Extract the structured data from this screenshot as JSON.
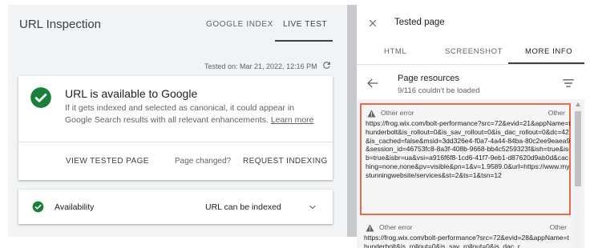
{
  "left_panel": {
    "title": "URL Inspection",
    "tabs": [
      {
        "label": "GOOGLE INDEX"
      },
      {
        "label": "LIVE TEST"
      }
    ],
    "tested_on": "Tested on: Mar 21, 2022, 12:16 PM",
    "status_card": {
      "title": "URL is available to Google",
      "description": "If it gets indexed and selected as canonical, it could appear in Google Search results with all relevant enhancements.",
      "learn_more": "Learn more",
      "view_tested_page": "VIEW TESTED PAGE",
      "page_changed": "Page changed?",
      "request_indexing": "REQUEST INDEXING"
    },
    "availability": {
      "label": "Availability",
      "value": "URL can be indexed"
    }
  },
  "right_panel": {
    "title": "Tested page",
    "tabs": [
      {
        "label": "HTML"
      },
      {
        "label": "SCREENSHOT"
      },
      {
        "label": "MORE INFO"
      }
    ],
    "resources": {
      "title": "Page resources",
      "subtitle": "9/116 couldn't be loaded"
    },
    "errors": [
      {
        "title": "Other error",
        "kind": "Other",
        "url": "https://frog.wix.com/bolt-performance?src=72&evid=21&appName=thunderbolt&is_rollout=0&is_sav_rollout=0&is_dac_rollout=0&dc=42&is_cached=false&msid=3dd326e4-f0a7-4a44-84ba-80c2ee9eaea9&session_id=46753fc8-8a3f-408b-9668-bb4c5259323f&ish=true&isb=true&isbr=ua&vsi=a916f6f8-1cd6-41f7-9eb1-d87620d9ab0d&caching=none,none&pv=visible&pn=1&v=1.9589.0&url=https://www.mystunningwebsite/services&st=2&ts=1&tsn=12"
      },
      {
        "title": "Other error",
        "kind": "Other",
        "url": "https://frog.wix.com/bolt-performance?src=72&evid=28&appName=thunderbolt&is_rollout=0&is_sav_rollout=0&is_dac_r"
      }
    ]
  },
  "colors": {
    "success_green": "#188038",
    "highlight_border": "#ea6b47",
    "panel_bg": "#f1f3f4"
  },
  "icons": {
    "refresh": "refresh-icon",
    "check": "check-circle-icon",
    "chevron": "chevron-down-icon",
    "close": "close-icon",
    "back": "arrow-back-icon",
    "filter": "filter-icon",
    "warning": "warning-icon"
  }
}
